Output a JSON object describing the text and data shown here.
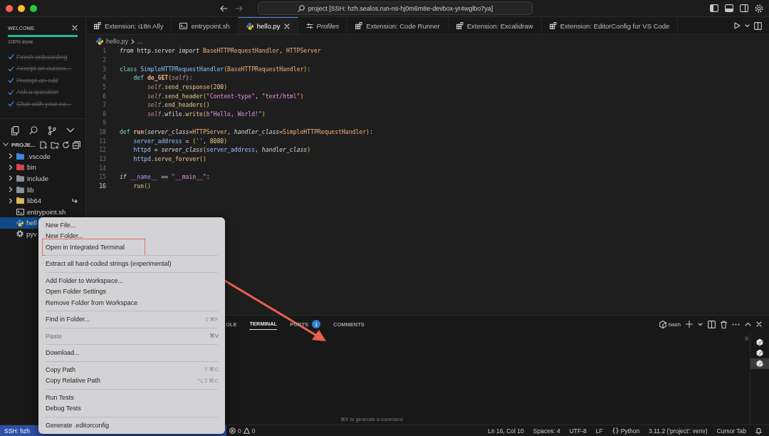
{
  "window": {
    "title": "project [SSH: hzh.sealos.run-ns-hj0m6m8e-devbox-yr4wglbo7ya]"
  },
  "welcome": {
    "title": "WELCOME",
    "level": 1,
    "progress_label": "100% done",
    "steps": [
      {
        "label": "Finish onboarding",
        "checked": true
      },
      {
        "label": "Accept an autoco...",
        "checked": true
      },
      {
        "label": "Prompt an edit",
        "checked": true
      },
      {
        "label": "Ask a question",
        "checked": true
      },
      {
        "label": "Chat with your co...",
        "checked": true
      }
    ]
  },
  "explorer": {
    "title": "PROJE...",
    "items": [
      {
        "label": ".vscode",
        "kind": "folder",
        "color": "#3f86d6",
        "expanded": false,
        "selected": false,
        "symlink": false
      },
      {
        "label": "bin",
        "kind": "folder",
        "color": "#d2474f",
        "expanded": false,
        "selected": false,
        "symlink": false
      },
      {
        "label": "include",
        "kind": "folder",
        "color": "#8a8f98",
        "expanded": false,
        "selected": false,
        "symlink": false
      },
      {
        "label": "lib",
        "kind": "folder",
        "color": "#8a8f98",
        "expanded": false,
        "selected": false,
        "symlink": false
      },
      {
        "label": "lib64",
        "kind": "folder",
        "color": "#d9b75b",
        "expanded": false,
        "selected": false,
        "symlink": true
      },
      {
        "label": "entrypoint.sh",
        "kind": "shell",
        "selected": false,
        "symlink": false
      },
      {
        "label": "hell",
        "kind": "python",
        "selected": true,
        "symlink": false
      },
      {
        "label": "pyv",
        "kind": "config",
        "selected": false,
        "symlink": false
      }
    ]
  },
  "tabs": [
    {
      "label": "Extension: i18n Ally",
      "kind": "extension",
      "selected": false,
      "preview": false
    },
    {
      "label": "entrypoint.sh",
      "kind": "shell",
      "selected": false,
      "preview": false
    },
    {
      "label": "hello.py",
      "kind": "python",
      "selected": true,
      "preview": false
    },
    {
      "label": "Profiles",
      "kind": "profiles",
      "selected": false,
      "preview": true
    },
    {
      "label": "Extension: Code Runner",
      "kind": "extension",
      "selected": false,
      "preview": false
    },
    {
      "label": "Extension: Excalidraw",
      "kind": "extension",
      "selected": false,
      "preview": false
    },
    {
      "label": "Extension: EditorConfig for VS Code",
      "kind": "extension",
      "selected": false,
      "preview": false
    }
  ],
  "breadcrumb": {
    "file": "hello.py",
    "rest": "..."
  },
  "code": [
    {
      "number": "1",
      "current": false,
      "tokens": [
        {
          "kind": "kwi",
          "text": "from"
        },
        {
          "kind": "p",
          "text": " http.server "
        },
        {
          "kind": "kwi",
          "text": "import "
        },
        {
          "kind": "type",
          "text": "BaseHTTPRequestHandler"
        },
        {
          "kind": "p",
          "text": ", "
        },
        {
          "kind": "type",
          "text": "HTTPServer"
        }
      ]
    },
    {
      "number": "2",
      "current": false
    },
    {
      "number": "3",
      "current": false,
      "tokens": [
        {
          "kind": "kw",
          "text": "class "
        },
        {
          "kind": "cls",
          "text": "SimpleHTTPRequestHandler"
        },
        {
          "kind": "paren",
          "text": "("
        },
        {
          "kind": "type",
          "text": "BaseHTTPRequestHandler"
        },
        {
          "kind": "paren",
          "text": ")"
        },
        {
          "kind": "p",
          "text": ":"
        }
      ]
    },
    {
      "number": "4",
      "current": false,
      "tokens": [
        {
          "kind": "kw",
          "text": "    def "
        },
        {
          "kind": "fnd",
          "text": "do_GET"
        },
        {
          "kind": "paren",
          "text": "("
        },
        {
          "kind": "self",
          "text": "self"
        },
        {
          "kind": "paren",
          "text": ")"
        },
        {
          "kind": "p",
          "text": ":"
        }
      ]
    },
    {
      "number": "5",
      "current": false,
      "tokens": [
        {
          "kind": "self",
          "text": "        self"
        },
        {
          "kind": "p",
          "text": "."
        },
        {
          "kind": "fn",
          "text": "send_response"
        },
        {
          "kind": "paren",
          "text": "("
        },
        {
          "kind": "num",
          "text": "200"
        },
        {
          "kind": "paren",
          "text": ")"
        }
      ]
    },
    {
      "number": "6",
      "current": false,
      "tokens": [
        {
          "kind": "self",
          "text": "        self"
        },
        {
          "kind": "p",
          "text": "."
        },
        {
          "kind": "fn",
          "text": "send_header"
        },
        {
          "kind": "paren",
          "text": "("
        },
        {
          "kind": "str",
          "text": "\"Content-type\""
        },
        {
          "kind": "p",
          "text": ", "
        },
        {
          "kind": "str",
          "text": "\"text/html\""
        },
        {
          "kind": "paren",
          "text": ")"
        }
      ]
    },
    {
      "number": "7",
      "current": false,
      "tokens": [
        {
          "kind": "self",
          "text": "        self"
        },
        {
          "kind": "p",
          "text": "."
        },
        {
          "kind": "fn",
          "text": "end_headers"
        },
        {
          "kind": "paren",
          "text": "()"
        }
      ]
    },
    {
      "number": "8",
      "current": false,
      "tokens": [
        {
          "kind": "self",
          "text": "        self"
        },
        {
          "kind": "p",
          "text": ".wfile."
        },
        {
          "kind": "fn",
          "text": "write"
        },
        {
          "kind": "paren",
          "text": "("
        },
        {
          "kind": "str",
          "text": "b\"Hello, World!\""
        },
        {
          "kind": "paren",
          "text": ")"
        }
      ]
    },
    {
      "number": "9",
      "current": false
    },
    {
      "number": "10",
      "current": false,
      "tokens": [
        {
          "kind": "kw",
          "text": "def "
        },
        {
          "kind": "fnd",
          "text": "run"
        },
        {
          "kind": "paren",
          "text": "("
        },
        {
          "kind": "param",
          "text": "server_class"
        },
        {
          "kind": "p",
          "text": "="
        },
        {
          "kind": "type",
          "text": "HTTPServer"
        },
        {
          "kind": "p",
          "text": ", "
        },
        {
          "kind": "param",
          "text": "handler_class"
        },
        {
          "kind": "p",
          "text": "="
        },
        {
          "kind": "type",
          "text": "SimpleHTTPRequestHandler"
        },
        {
          "kind": "paren",
          "text": ")"
        },
        {
          "kind": "p",
          "text": ":"
        }
      ]
    },
    {
      "number": "11",
      "current": false,
      "tokens": [
        {
          "kind": "var",
          "text": "    server_address"
        },
        {
          "kind": "p",
          "text": " = "
        },
        {
          "kind": "paren",
          "text": "("
        },
        {
          "kind": "str",
          "text": "''"
        },
        {
          "kind": "p",
          "text": ", "
        },
        {
          "kind": "num",
          "text": "8080"
        },
        {
          "kind": "paren",
          "text": ")"
        }
      ]
    },
    {
      "number": "12",
      "current": false,
      "tokens": [
        {
          "kind": "var",
          "text": "    httpd"
        },
        {
          "kind": "p",
          "text": " = "
        },
        {
          "kind": "param",
          "text": "server_class"
        },
        {
          "kind": "paren",
          "text": "("
        },
        {
          "kind": "var",
          "text": "server_address"
        },
        {
          "kind": "p",
          "text": ", "
        },
        {
          "kind": "param",
          "text": "handler_class"
        },
        {
          "kind": "paren",
          "text": ")"
        }
      ]
    },
    {
      "number": "13",
      "current": false,
      "tokens": [
        {
          "kind": "var",
          "text": "    httpd"
        },
        {
          "kind": "p",
          "text": "."
        },
        {
          "kind": "fn",
          "text": "serve_forever"
        },
        {
          "kind": "paren",
          "text": "()"
        }
      ]
    },
    {
      "number": "14",
      "current": false
    },
    {
      "number": "15",
      "current": false,
      "tokens": [
        {
          "kind": "kwi",
          "text": "if "
        },
        {
          "kind": "dunder",
          "text": "__name__"
        },
        {
          "kind": "p",
          "text": " == "
        },
        {
          "kind": "str",
          "text": "\"__main__\""
        },
        {
          "kind": "p",
          "text": ":"
        }
      ]
    },
    {
      "number": "16",
      "current": true,
      "tokens": [
        {
          "kind": "fn",
          "text": "    run"
        },
        {
          "kind": "paren",
          "text": "()"
        }
      ]
    }
  ],
  "context_menu": [
    {
      "kind": "item",
      "label": "New File...",
      "disabled": false,
      "highlighted": false
    },
    {
      "kind": "item",
      "label": "New Folder...",
      "disabled": false,
      "highlighted": false
    },
    {
      "kind": "item",
      "label": "Open in Integrated Terminal",
      "disabled": false,
      "highlighted": true
    },
    {
      "kind": "separator"
    },
    {
      "kind": "item",
      "label": "Extract all hard-coded strings (experimental)",
      "disabled": false,
      "highlighted": false
    },
    {
      "kind": "separator"
    },
    {
      "kind": "item",
      "label": "Add Folder to Workspace...",
      "disabled": false,
      "highlighted": false
    },
    {
      "kind": "item",
      "label": "Open Folder Settings",
      "disabled": false,
      "highlighted": false
    },
    {
      "kind": "item",
      "label": "Remove Folder from Workspace",
      "disabled": false,
      "highlighted": false
    },
    {
      "kind": "separator"
    },
    {
      "kind": "item",
      "label": "Find in Folder...",
      "shortcut": "⇧⌘F",
      "disabled": false,
      "highlighted": false
    },
    {
      "kind": "separator"
    },
    {
      "kind": "item",
      "label": "Paste",
      "shortcut": "⌘V",
      "disabled": true,
      "highlighted": false
    },
    {
      "kind": "separator"
    },
    {
      "kind": "item",
      "label": "Download...",
      "disabled": false,
      "highlighted": false
    },
    {
      "kind": "separator"
    },
    {
      "kind": "item",
      "label": "Copy Path",
      "shortcut": "⇧⌘C",
      "disabled": false,
      "highlighted": false
    },
    {
      "kind": "item",
      "label": "Copy Relative Path",
      "shortcut": "⌥⇧⌘C",
      "disabled": false,
      "highlighted": false
    },
    {
      "kind": "separator"
    },
    {
      "kind": "item",
      "label": "Run Tests",
      "disabled": false,
      "highlighted": false
    },
    {
      "kind": "item",
      "label": "Debug Tests",
      "disabled": false,
      "highlighted": false
    },
    {
      "kind": "separator"
    },
    {
      "kind": "item",
      "label": "Generate .editorconfig",
      "disabled": false,
      "highlighted": false
    }
  ],
  "panel": {
    "tabs": [
      {
        "label": "OLE",
        "selected": false
      },
      {
        "label": "TERMINAL",
        "selected": true
      },
      {
        "label": "PORTS",
        "selected": false,
        "badge": "1"
      },
      {
        "label": "COMMENTS",
        "selected": false
      }
    ],
    "terminal_name": "bash",
    "hint": "⌘K to generate a command",
    "terminals": [
      {
        "selected": false
      },
      {
        "selected": false
      },
      {
        "selected": true
      }
    ]
  },
  "status_bar": {
    "remote": "SSH: hzh",
    "errors": "0",
    "warnings": "0",
    "items": [
      {
        "kind": "text",
        "text": "Ln 16, Col 10"
      },
      {
        "kind": "text",
        "text": "Spaces: 4"
      },
      {
        "kind": "text",
        "text": "UTF-8"
      },
      {
        "kind": "text",
        "text": "LF"
      },
      {
        "kind": "language",
        "text": "Python"
      },
      {
        "kind": "text",
        "text": "3.11.2 ('project': venv)"
      },
      {
        "kind": "text",
        "text": "Cursor Tab"
      }
    ]
  }
}
